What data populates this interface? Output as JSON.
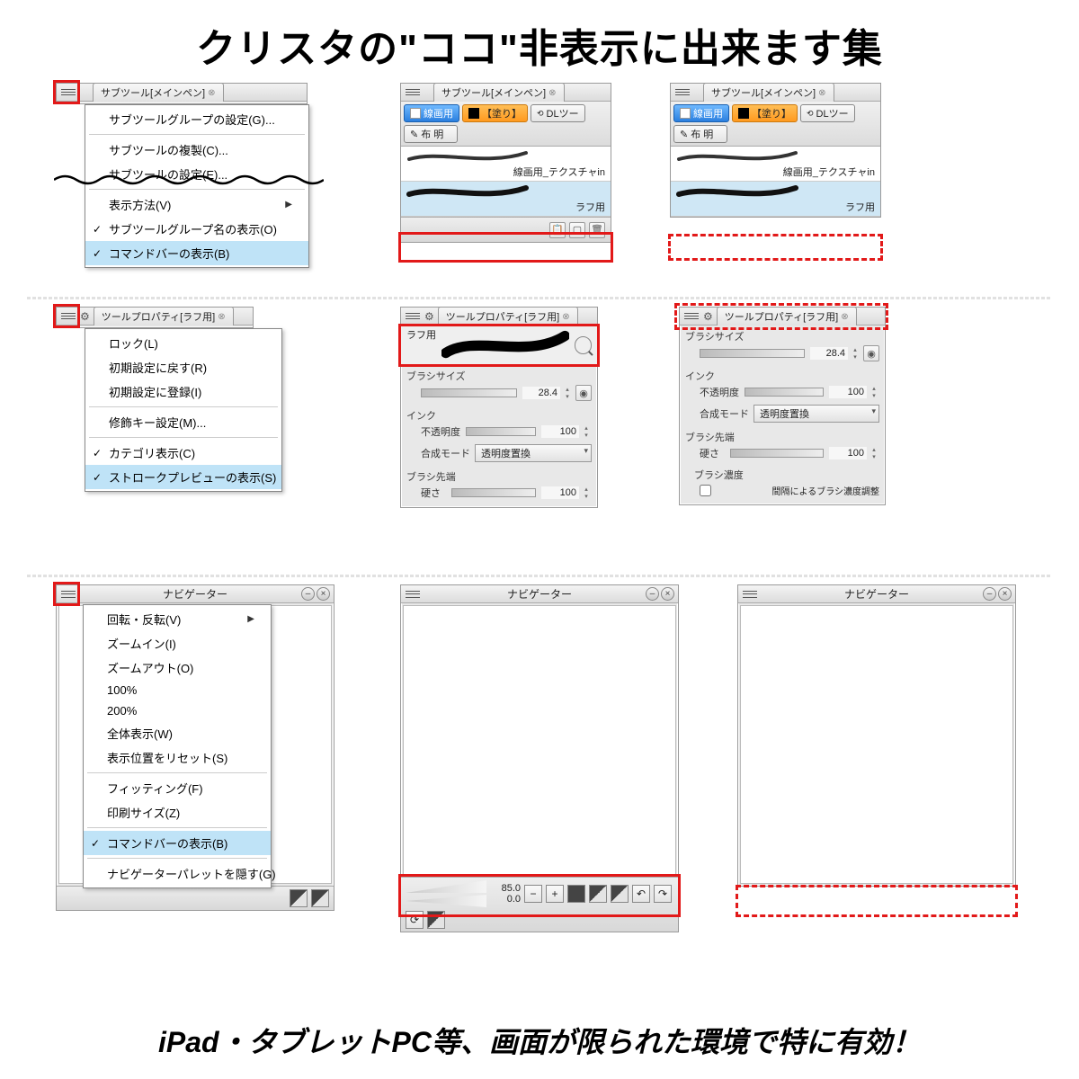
{
  "headline": "クリスタの\"ココ\"非表示に出来ます集",
  "footline": "iPad・タブレットPC等、画面が限られた環境で特に有効！",
  "row1": {
    "subtool_tab": "サブツール[メインペン]",
    "menu": {
      "group_settings": "サブツールグループの設定(G)...",
      "duplicate": "サブツールの複製(C)...",
      "settings": "サブツールの設定(E)...",
      "display_method": "表示方法(V)",
      "show_groupname": "サブツールグループ名の表示(O)",
      "show_commandbar": "コマンドバーの表示(B)"
    },
    "btn_line": "線画用",
    "btn_fill": "【塗り】",
    "btn_dl": "DLツー",
    "btn_cloth": "布 明",
    "brush_a": "線画用_テクスチャin",
    "brush_b": "ラフ用"
  },
  "row2": {
    "prop_tab": "ツールプロパティ[ラフ用]",
    "menu": {
      "lock": "ロック(L)",
      "reset": "初期設定に戻す(R)",
      "register": "初期設定に登録(I)",
      "modkey": "修飾キー設定(M)...",
      "category": "カテゴリ表示(C)",
      "stroke_preview": "ストロークプレビューの表示(S)"
    },
    "preview_label": "ラフ用",
    "brush_size_lbl": "ブラシサイズ",
    "brush_size_val": "28.4",
    "ink_lbl": "インク",
    "opacity_lbl": "不透明度",
    "opacity_val": "100",
    "blend_lbl": "合成モード",
    "blend_val": "透明度置換",
    "tip_lbl": "ブラシ先端",
    "hardness_lbl": "硬さ",
    "hardness_val": "100",
    "density_lbl": "ブラシ濃度",
    "density_chk": "間隔によるブラシ濃度調整"
  },
  "row3": {
    "nav_title": "ナビゲーター",
    "menu": {
      "rotate": "回転・反転(V)",
      "zoomin": "ズームイン(I)",
      "zoomout": "ズームアウト(O)",
      "p100": "100%",
      "p200": "200%",
      "fit": "全体表示(W)",
      "reset_pos": "表示位置をリセット(S)",
      "fitting": "フィッティング(F)",
      "print_size": "印刷サイズ(Z)",
      "show_cmdbar": "コマンドバーの表示(B)",
      "hide_palette": "ナビゲーターパレットを隠す(G)"
    },
    "zoom_val": "85.0",
    "rot_val": "0.0"
  }
}
